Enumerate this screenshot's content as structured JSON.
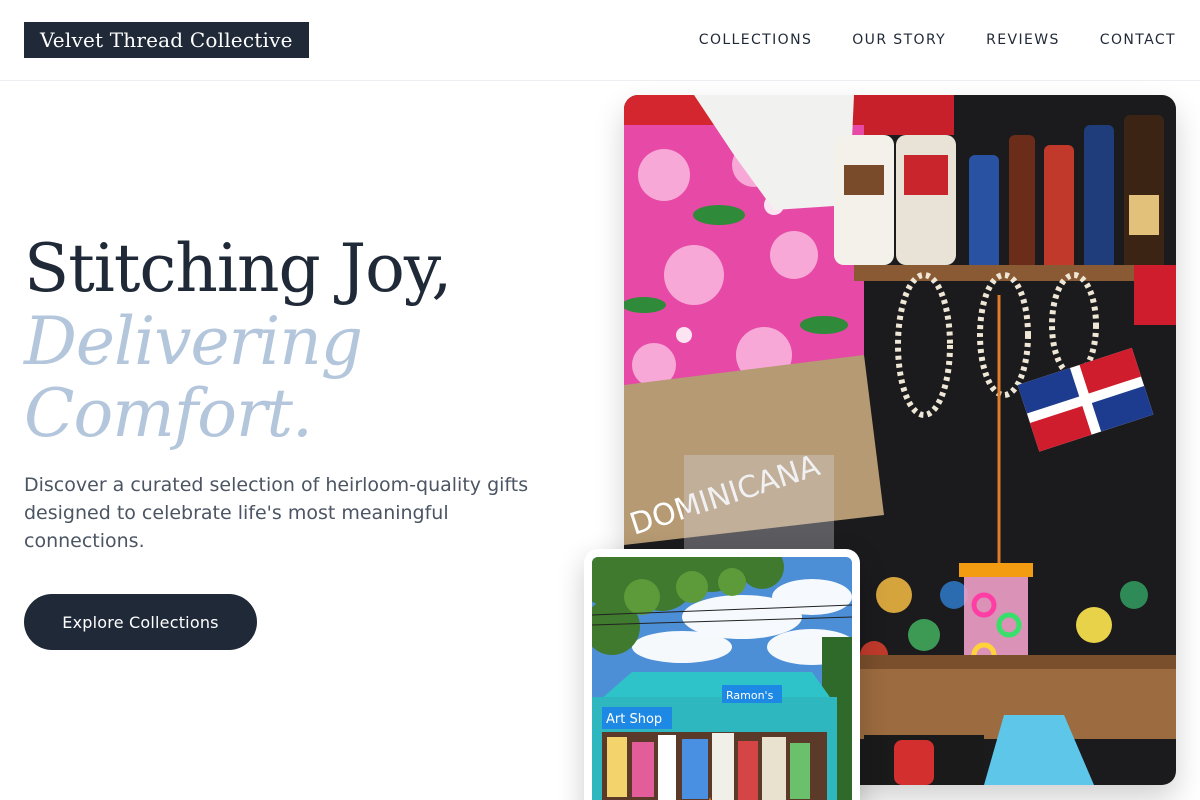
{
  "brand": {
    "name": "Velvet Thread Collective"
  },
  "nav": {
    "items": [
      {
        "label": "COLLECTIONS"
      },
      {
        "label": "OUR STORY"
      },
      {
        "label": "REVIEWS"
      },
      {
        "label": "CONTACT"
      }
    ]
  },
  "hero": {
    "title_line1": "Stitching Joy,",
    "title_line2": "Delivering",
    "title_line3": "Comfort.",
    "description": "Discover a curated selection of heirloom-quality gifts designed to celebrate life's most meaningful connections.",
    "cta_label": "Explore Collections"
  },
  "images": {
    "main_alt": "Market stall with floral fabrics, shell necklaces and bottles",
    "inset_alt": "Colorful roadside gift shop under blue sky"
  },
  "colors": {
    "primary": "#1f2937",
    "accent_light_blue": "#b3c6db",
    "text_muted": "#4b5563",
    "border": "#eceef1"
  }
}
